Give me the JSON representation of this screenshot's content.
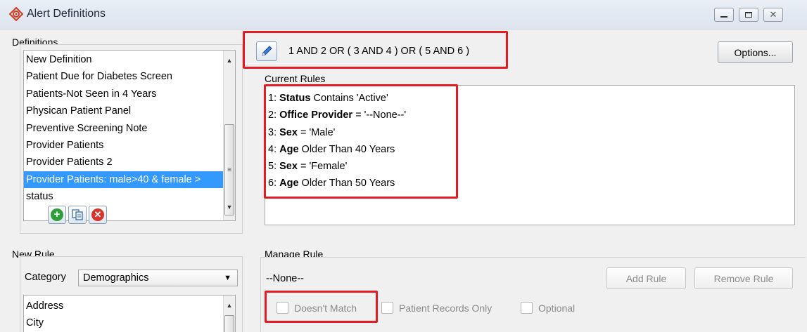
{
  "window": {
    "title": "Alert Definitions",
    "minimize_icon": "minimize-icon",
    "restore_icon": "restore-icon",
    "close_icon": "close-icon"
  },
  "definitions": {
    "label": "Definitions",
    "items": [
      "New Definition",
      "Patient Due for Diabetes Screen",
      "Patients-Not Seen in 4 Years",
      "Physican Patient Panel",
      "Preventive Screening Note",
      "Provider Patients",
      "Provider Patients 2",
      "Provider Patients: male>40 & female >",
      "status"
    ],
    "selected_index": 7,
    "add_icon": "add-icon",
    "copy_icon": "copy-icon",
    "delete_icon": "delete-icon"
  },
  "expression": {
    "edit_icon": "pencil-icon",
    "text": "1 AND 2 OR ( 3 AND 4 ) OR ( 5 AND 6 )"
  },
  "options_button": "Options...",
  "current_rules": {
    "label": "Current Rules",
    "rules": [
      {
        "prefix": "1: ",
        "field": "Status",
        "rest": " Contains 'Active'"
      },
      {
        "prefix": "2: ",
        "field": "Office Provider",
        "rest": " = '--None--'"
      },
      {
        "prefix": "3: ",
        "field": "Sex",
        "rest": " = 'Male'"
      },
      {
        "prefix": "4: ",
        "field": "Age",
        "rest": " Older Than 40 Years"
      },
      {
        "prefix": "5: ",
        "field": "Sex",
        "rest": " = 'Female'"
      },
      {
        "prefix": "6: ",
        "field": "Age",
        "rest": " Older Than 50 Years"
      }
    ]
  },
  "new_rule": {
    "label": "New Rule",
    "category_label": "Category",
    "category_value": "Demographics",
    "items": [
      "Address",
      "City"
    ]
  },
  "manage_rule": {
    "label": "Manage Rule",
    "current": "--None--",
    "add_button": "Add Rule",
    "remove_button": "Remove Rule",
    "doesnt_match": "Doesn't Match",
    "patient_records_only": "Patient Records Only",
    "optional": "Optional"
  },
  "colors": {
    "selection": "#3399ff",
    "highlight_box": "#e31b23",
    "add_green": "#2e9e3b",
    "delete_red": "#d9342b"
  }
}
